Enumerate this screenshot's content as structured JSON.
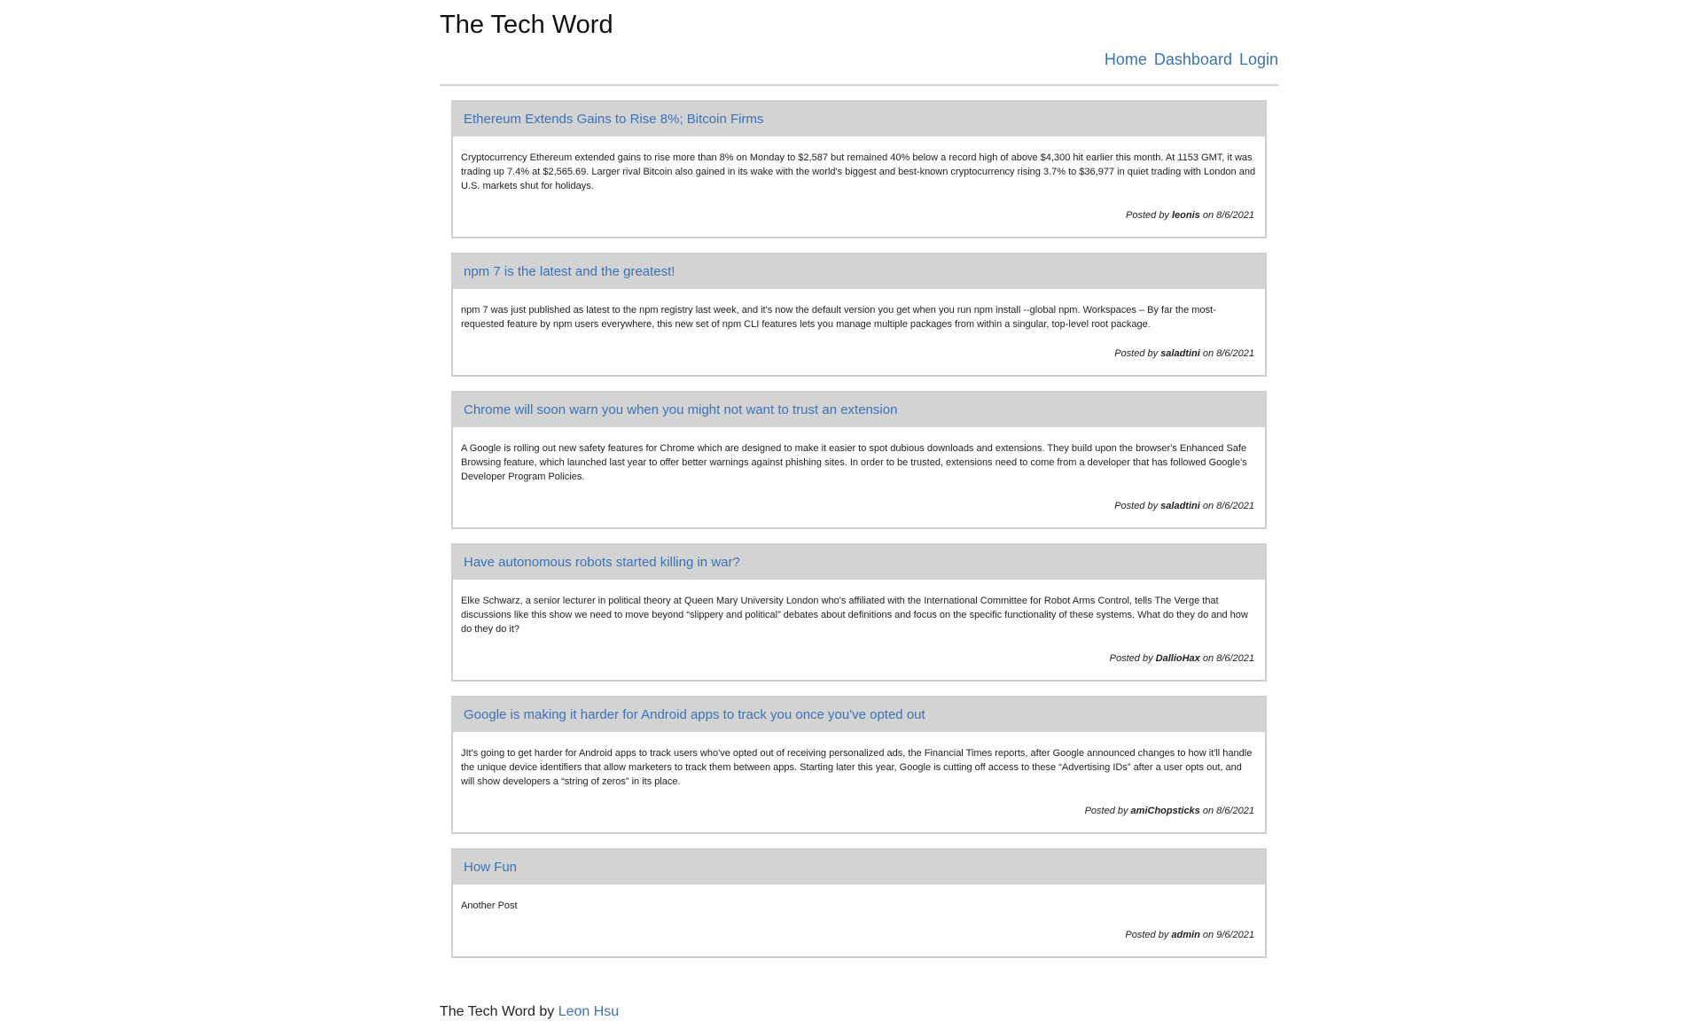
{
  "site": {
    "title": "The Tech Word"
  },
  "nav": {
    "items": [
      {
        "label": "Home"
      },
      {
        "label": "Dashboard"
      },
      {
        "label": "Login"
      }
    ]
  },
  "posts": [
    {
      "title": "Ethereum Extends Gains to Rise 8%; Bitcoin Firms",
      "body": "Cryptocurrency Ethereum extended gains to rise more than 8% on Monday to $2,587 but remained 40% below a record high of above $4,300 hit earlier this month. At 1153 GMT, it was trading up 7.4% at $2,565.69. Larger rival Bitcoin also gained in its wake with the world's biggest and best-known cryptocurrency rising 3.7% to $36,977 in quiet trading with London and U.S. markets shut for holidays.",
      "posted_by_prefix": "Posted by",
      "author": "leonis",
      "on_label": "on",
      "date": "8/6/2021"
    },
    {
      "title": "npm 7 is the latest and the greatest!",
      "body": "npm 7 was just published as latest to the npm registry last week, and it's now the default version you get when you run npm install --global npm. Workspaces – By far the most-requested feature by npm users everywhere, this new set of npm CLI features lets you manage multiple packages from within a singular, top-level root package.",
      "posted_by_prefix": "Posted by",
      "author": "saladtini",
      "on_label": "on",
      "date": "8/6/2021"
    },
    {
      "title": "Chrome will soon warn you when you might not want to trust an extension",
      "body": "A Google is rolling out new safety features for Chrome which are designed to make it easier to spot dubious downloads and extensions. They build upon the browser's Enhanced Safe Browsing feature, which launched last year to offer better warnings against phishing sites. In order to be trusted, extensions need to come from a developer that has followed Google's Developer Program Policies.",
      "posted_by_prefix": "Posted by",
      "author": "saladtini",
      "on_label": "on",
      "date": "8/6/2021"
    },
    {
      "title": "Have autonomous robots started killing in war?",
      "body": "Elke Schwarz, a senior lecturer in political theory at Queen Mary University London who's affiliated with the International Committee for Robot Arms Control, tells The Verge that discussions like this show we need to move beyond “slippery and political” debates about definitions and focus on the specific functionality of these systems. What do they do and how do they do it?",
      "posted_by_prefix": "Posted by",
      "author": "DallioHax",
      "on_label": "on",
      "date": "8/6/2021"
    },
    {
      "title": "Google is making it harder for Android apps to track you once you've opted out",
      "body": "JIt's going to get harder for Android apps to track users who've opted out of receiving personalized ads, the Financial Times reports, after Google announced changes to how it'll handle the unique device identifiers that allow marketers to track them between apps. Starting later this year, Google is cutting off access to these “Advertising IDs” after a user opts out, and will show developers a “string of zeros” in its place.",
      "posted_by_prefix": "Posted by",
      "author": "amiChopsticks",
      "on_label": "on",
      "date": "8/6/2021"
    },
    {
      "title": "How Fun",
      "body": "Another Post",
      "posted_by_prefix": "Posted by",
      "author": "admin",
      "on_label": "on",
      "date": "9/6/2021"
    }
  ],
  "footer": {
    "text": "The Tech Word by",
    "author_link": "Leon Hsu"
  }
}
